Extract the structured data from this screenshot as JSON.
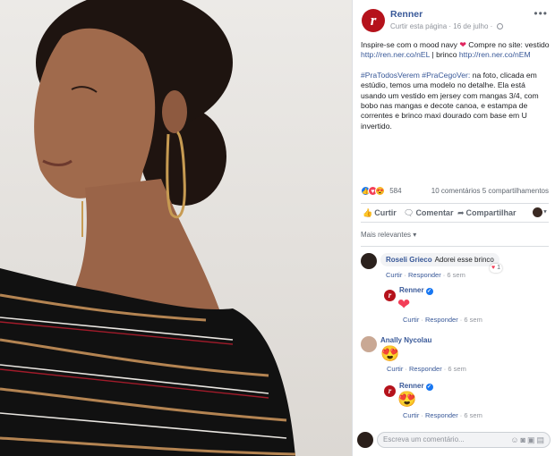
{
  "post": {
    "page_name": "Renner",
    "page_initial": "r",
    "like_page": "Curtir esta página",
    "date": "16 de julho",
    "paragraph1_a": "Inspire-se com o mood navy",
    "paragraph1_b": "Compre no site:",
    "paragraph1_c": "vestido",
    "link_vestido": "http://ren.ner.co/nEL",
    "paragraph1_d": "| brinco",
    "link_brinco": "http://ren.ner.co/nEM",
    "hashtags": "#PraTodosVerem #PraCegoVer:",
    "paragraph2": "na foto, clicada em estúdio, temos uma modelo no detalhe. Ela está usando um vestido em jersey com mangas 3/4, com bobo nas mangas e decote canoa, e estampa de correntes e brinco maxi dourado com base em U invertido."
  },
  "reactions": {
    "count": "584",
    "comments": "10 comentários",
    "shares": "5 compartilhamentos"
  },
  "actions": {
    "like": "Curtir",
    "comment": "Comentar",
    "share": "Compartilhar"
  },
  "sort": {
    "label": "Mais relevantes ▾"
  },
  "comments": [
    {
      "name": "Roseli Grieco",
      "text": "Adorei esse brinco",
      "like": "Curtir",
      "reply": "Responder",
      "time": "6 sem",
      "badge_count": "1",
      "reply_item": {
        "name": "Renner",
        "like": "Curtir",
        "reply": "Responder",
        "time": "6 sem"
      }
    },
    {
      "name": "Anally Nycolau",
      "like": "Curtir",
      "reply": "Responder",
      "time": "6 sem",
      "reply_item": {
        "name": "Renner",
        "like": "Curtir",
        "reply": "Responder",
        "time": "6 sem"
      }
    }
  ],
  "composer": {
    "placeholder": "Escreva um comentário..."
  },
  "colors": {
    "brand": "#b5121b",
    "link": "#385898",
    "like_blue": "#1877f2",
    "love_red": "#f33e58",
    "wow_yellow": "#f7b125"
  },
  "icons": [
    "globe-icon",
    "more-options-icon",
    "like-icon",
    "comment-icon",
    "share-icon",
    "verified-icon",
    "heart-emoji",
    "heart-eyes-emoji",
    "emoji-icon",
    "camera-icon",
    "gif-icon",
    "sticker-icon"
  ]
}
